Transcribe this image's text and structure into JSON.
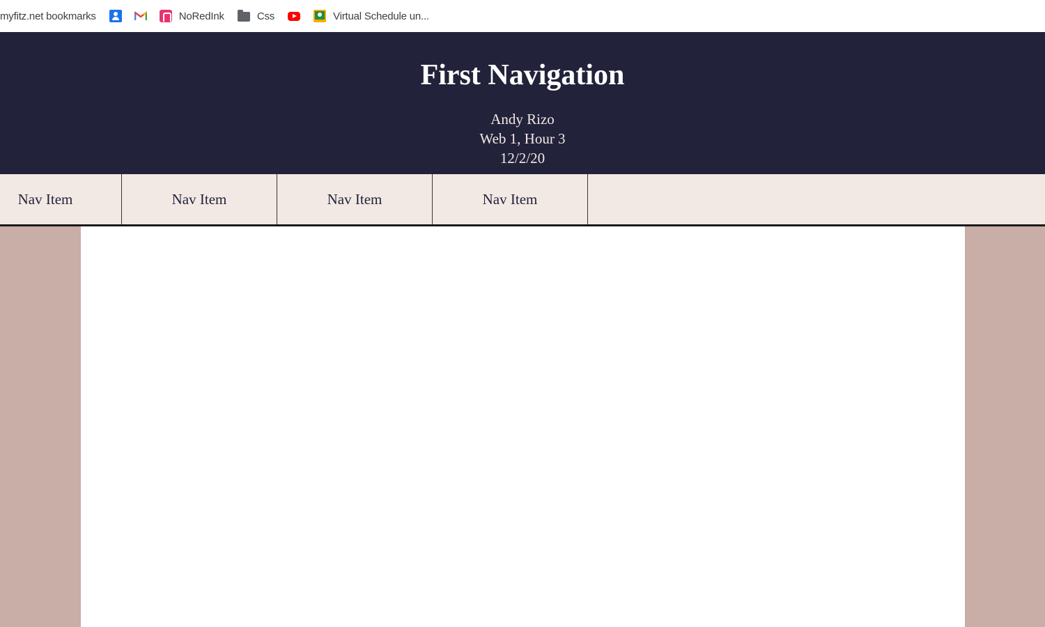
{
  "bookmarks": [
    {
      "label": "myfitz.net bookmarks",
      "icon": "none"
    },
    {
      "label": "",
      "icon": "contacts-icon"
    },
    {
      "label": "",
      "icon": "gmail-icon"
    },
    {
      "label": "NoRedInk",
      "icon": "noredink-icon"
    },
    {
      "label": "Css",
      "icon": "folder-icon"
    },
    {
      "label": "",
      "icon": "youtube-icon"
    },
    {
      "label": "Virtual Schedule un...",
      "icon": "classroom-icon"
    }
  ],
  "header": {
    "title": "First Navigation",
    "author": "Andy Rizo",
    "class_info": "Web 1, Hour 3",
    "date": "12/2/20"
  },
  "nav": {
    "items": [
      {
        "label": "Nav Item"
      },
      {
        "label": "Nav Item"
      },
      {
        "label": "Nav Item"
      },
      {
        "label": "Nav Item"
      }
    ]
  },
  "colors": {
    "header_bg": "#22223b",
    "nav_bg": "#f2e9e4",
    "sidebar_bg": "#c9ada7",
    "content_bg": "#ffffff"
  }
}
